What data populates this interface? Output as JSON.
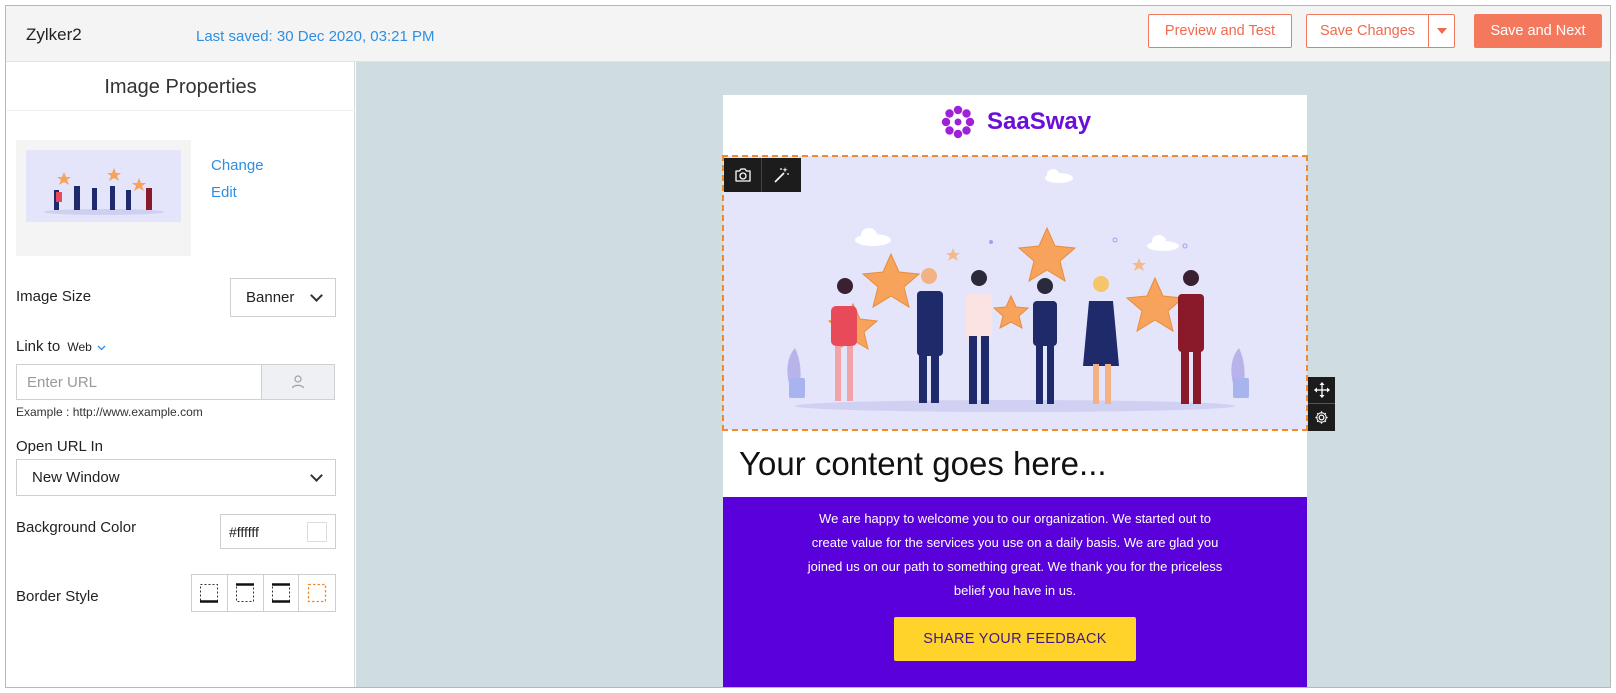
{
  "header": {
    "app_title": "Zylker2",
    "last_saved": "Last saved: 30 Dec 2020, 03:21 PM",
    "preview_label": "Preview and Test",
    "save_label": "Save Changes",
    "next_label": "Save and Next"
  },
  "panel": {
    "title": "Image Properties",
    "change_label": "Change",
    "edit_label": "Edit",
    "image_size_label": "Image Size",
    "image_size_value": "Banner",
    "link_to_label": "Link to",
    "link_type": "Web",
    "url_placeholder": "Enter URL",
    "example_text": "Example : http://www.example.com",
    "open_url_label": "Open URL In",
    "open_url_value": "New Window",
    "bg_color_label": "Background Color",
    "bg_color_value": "#ffffff",
    "border_style_label": "Border Style"
  },
  "email": {
    "brand_name": "SaaSway",
    "headline": "Your content goes here...",
    "body": "We are happy to welcome you to our organization. We started out to create value for the services you use on a daily basis. We are glad you joined us on our path to something great. We thank you for the priceless belief you have in us.",
    "cta_label": "SHARE YOUR FEEDBACK"
  },
  "colors": {
    "accent": "#f3785c",
    "link": "#2f8ee0",
    "canvas_bg": "#cfdde0",
    "brand_purple": "#5a00da",
    "cta_yellow": "#ffd32a",
    "selection_outline": "#f08a2a"
  }
}
